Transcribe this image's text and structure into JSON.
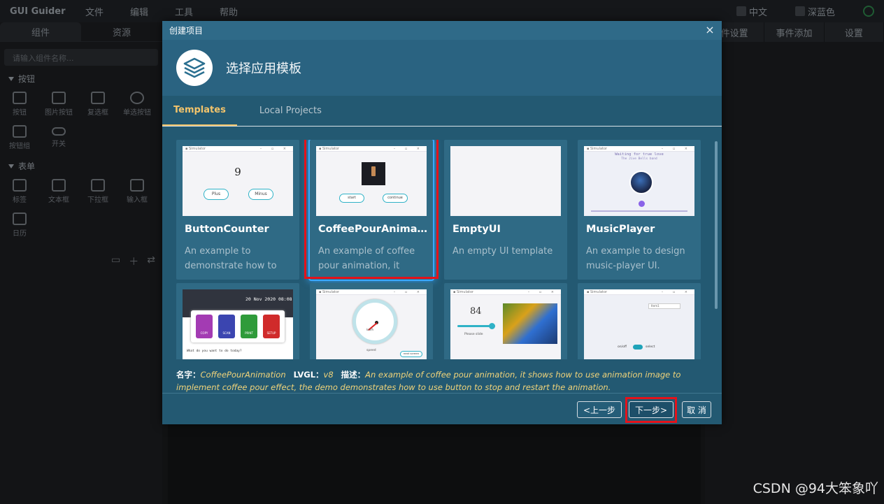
{
  "app": {
    "brand": "GUI Guider",
    "menu": [
      "文件",
      "编辑",
      "工具",
      "帮助"
    ],
    "lang_label": "中文",
    "theme_label": "深蓝色"
  },
  "left_panel": {
    "tabs": [
      "组件",
      "资源"
    ],
    "search_placeholder": "请输入组件名称...",
    "groups": [
      {
        "title": "按钮",
        "items": [
          "按钮",
          "图片按钮",
          "复选框",
          "单选按钮",
          "按钮组",
          "开关"
        ]
      },
      {
        "title": "表单",
        "items": [
          "标签",
          "文本框",
          "下拉框",
          "输入框",
          "日历"
        ]
      }
    ]
  },
  "right_panel": {
    "tabs": [
      "件设置",
      "事件添加",
      "设置"
    ]
  },
  "dialog": {
    "title": "创建项目",
    "close_label": "×",
    "header": "选择应用模板",
    "tabs": [
      "Templates",
      "Local Projects"
    ],
    "active_tab": "Templates",
    "templates": [
      {
        "name": "ButtonCounter",
        "desc": "An example to demonstrate how to",
        "thumb": {
          "counter": "9",
          "btn1": "Plus",
          "btn2": "Minus"
        }
      },
      {
        "name": "CoffeePourAnimat...",
        "desc": "An example of coffee pour animation, it",
        "selected": true,
        "thumb": {
          "btn1": "start",
          "btn2": "continue"
        }
      },
      {
        "name": "EmptyUI",
        "desc": "An empty UI template"
      },
      {
        "name": "MusicPlayer",
        "desc": "An example to design music-player UI.",
        "thumb": {
          "title": "Waiting for true love",
          "subtitle": "The Jive Bells band"
        }
      },
      {
        "name": "",
        "desc": "",
        "thumb": {
          "date": "20 Nov 2020 08:08",
          "prompt": "What do you want to do today?",
          "tiles": [
            "COPY",
            "SCAN",
            "PRINT",
            "SETUP"
          ]
        }
      },
      {
        "name": "",
        "desc": "",
        "thumb": {
          "unit": "km/h",
          "caption": "speed",
          "btn": "next screen"
        }
      },
      {
        "name": "",
        "desc": "",
        "thumb": {
          "value": "84",
          "caption": "Please slide"
        }
      },
      {
        "name": "",
        "desc": "",
        "thumb": {
          "dropdown": "Item1",
          "switch_label_left": "on/off",
          "switch_label_right": "select"
        }
      }
    ],
    "info": {
      "name_label": "名字：",
      "name_value": "CoffeePourAnimation",
      "lvgl_label": "LVGL：",
      "lvgl_value": "v8",
      "desc_label": "描述：",
      "desc_value": "An example of coffee pour animation, it shows how to use animation image to implement coffee pour effect, the demo demonstrates how to use button to stop and restart the animation."
    },
    "buttons": {
      "prev": "<上一步",
      "next": "下一步>",
      "cancel": "取 消"
    }
  },
  "watermark": "CSDN @94大笨象吖"
}
